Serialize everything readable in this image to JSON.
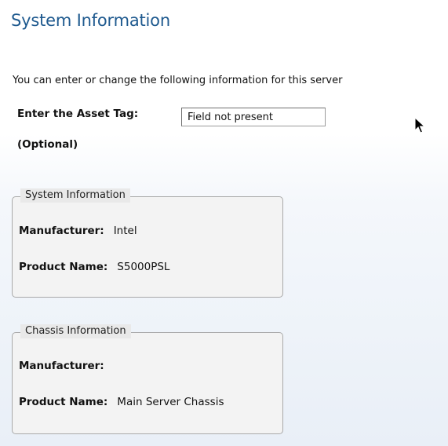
{
  "page": {
    "title": "System Information",
    "intro": "You can enter or change the following information for this server"
  },
  "asset_tag": {
    "label": "Enter the Asset Tag:",
    "optional_label": "(Optional)",
    "value": "Field not present"
  },
  "system_info": {
    "legend": "System Information",
    "manufacturer_label": "Manufacturer:",
    "manufacturer_value": "Intel",
    "product_label": "Product Name:",
    "product_value": "S5000PSL"
  },
  "chassis_info": {
    "legend": "Chassis Information",
    "manufacturer_label": "Manufacturer:",
    "manufacturer_value": "",
    "product_label": "Product Name:",
    "product_value": "Main Server Chassis"
  },
  "colors": {
    "title": "#1f5a8f",
    "fieldset_border": "#a9a9a9",
    "fieldset_bg": "#f3f3f3",
    "legend_bg": "#e9e9e9"
  },
  "icons": {
    "pointer": "mouse-pointer-icon"
  }
}
